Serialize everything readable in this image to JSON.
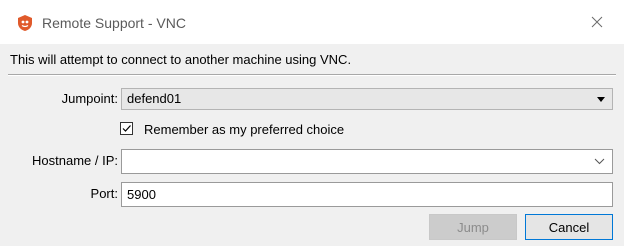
{
  "window": {
    "title": "Remote Support - VNC",
    "icon": "remote-support-app-icon",
    "close_icon": "close-icon"
  },
  "intro": "This will attempt to connect to another machine using VNC.",
  "form": {
    "jumpoint_label": "Jumpoint:",
    "jumpoint_value": "defend01",
    "remember_label": "Remember as my preferred choice",
    "remember_checked": true,
    "hostname_label": "Hostname / IP:",
    "hostname_value": "",
    "port_label": "Port:",
    "port_value": "5900"
  },
  "buttons": {
    "jump": "Jump",
    "jump_enabled": false,
    "cancel": "Cancel"
  },
  "colors": {
    "accent": "#0078d7",
    "app_icon": "#e05a2b"
  }
}
